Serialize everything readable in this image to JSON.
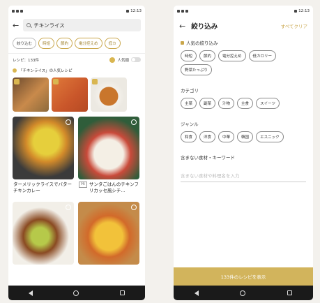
{
  "status_bar": {
    "time": "12:13"
  },
  "left": {
    "search_query": "チキンライス",
    "chips": [
      "絞り込む",
      "時短",
      "節約",
      "電分控えめ",
      "低カ"
    ],
    "recipe_count": "レシピ：133件",
    "popular_label": "人気順",
    "popular_section_title": "「チキンライス」の人気レシピ",
    "cards": [
      {
        "title": "ターメリックライスでバターチキンカレー",
        "pr": ""
      },
      {
        "title": "サンタごはんのチキンフリカッセ風シチ...",
        "pr": "PR"
      },
      {
        "title": "",
        "pr": ""
      },
      {
        "title": "",
        "pr": ""
      }
    ]
  },
  "right": {
    "title": "絞り込み",
    "clear_all": "すべてクリア",
    "popular_filter_label": "人気の絞り込み",
    "popular_tags": [
      "時短",
      "節約",
      "電分控えめ",
      "低カロリー",
      "野菜たっぷり"
    ],
    "category_label": "カテゴリ",
    "category_tags": [
      "主菜",
      "副菜",
      "汁物",
      "主食",
      "スイーツ"
    ],
    "genre_label": "ジャンル",
    "genre_tags": [
      "和食",
      "洋食",
      "中華",
      "韓国",
      "エスニック"
    ],
    "exclude_label": "含まない食材・キーワード",
    "exclude_placeholder": "含まない食材や料理名を入力",
    "show_button": "133件のレシピを表示"
  },
  "colors": {
    "accent": "#c9a64a",
    "button": "#d2b45c",
    "nav": "#1a1a1a"
  }
}
